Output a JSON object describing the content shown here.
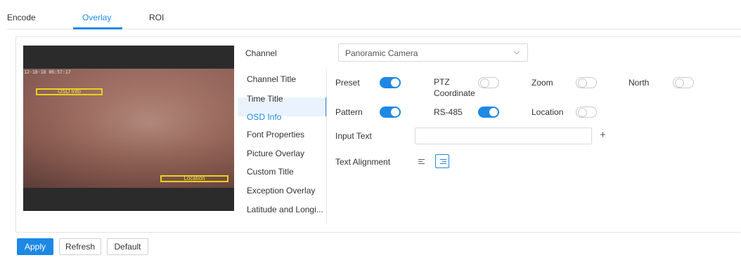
{
  "tabs": [
    {
      "label": "Encode",
      "active": false
    },
    {
      "label": "Overlay",
      "active": true
    },
    {
      "label": "ROI",
      "active": false
    }
  ],
  "preview": {
    "time_text": "12-18-18 06:57:17",
    "osd_info_label": "OSD Info",
    "location_label": "Location"
  },
  "channel": {
    "label": "Channel",
    "value": "Panoramic Camera"
  },
  "menu": {
    "items": [
      "Channel Title",
      "Time Title",
      "OSD Info",
      "Font Properties",
      "Picture Overlay",
      "Custom Title",
      "Exception Overlay",
      "Latitude and Longi..."
    ],
    "active_index": 2
  },
  "settings": {
    "preset": {
      "label": "Preset",
      "on": true
    },
    "ptz": {
      "label_line1": "PTZ",
      "label_line2": "Coordinate",
      "on": false
    },
    "zoom": {
      "label": "Zoom",
      "on": false
    },
    "north": {
      "label": "North",
      "on": false
    },
    "pattern": {
      "label": "Pattern",
      "on": true
    },
    "rs485": {
      "label": "RS-485",
      "on": true
    },
    "location": {
      "label": "Location",
      "on": false
    },
    "input_text": {
      "label": "Input Text",
      "value": "",
      "plus": "+"
    },
    "text_alignment": {
      "label": "Text Alignment",
      "selected": "right"
    }
  },
  "buttons": {
    "apply": "Apply",
    "refresh": "Refresh",
    "default": "Default"
  },
  "colors": {
    "accent": "#1e88e5",
    "osd_box": "#e7d31b"
  }
}
